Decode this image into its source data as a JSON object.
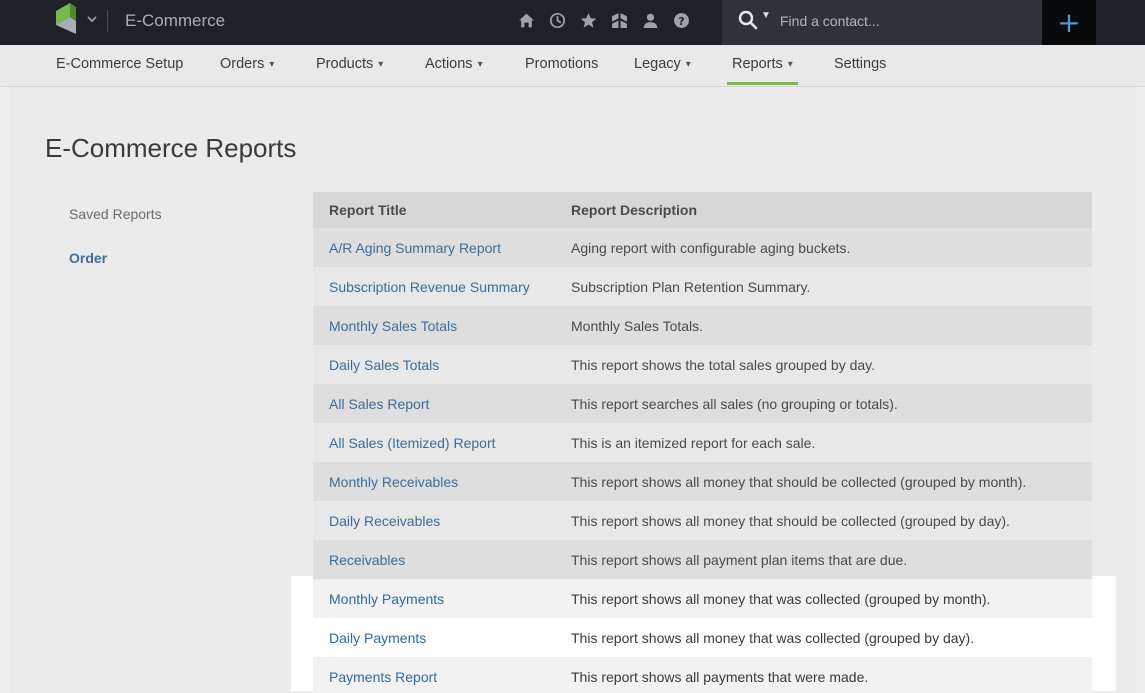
{
  "app": {
    "title": "E-Commerce"
  },
  "search": {
    "placeholder": "Find a contact..."
  },
  "add_label": "+",
  "nav": {
    "items": [
      {
        "label": "E-Commerce Setup"
      },
      {
        "label": "Orders"
      },
      {
        "label": "Products"
      },
      {
        "label": "Actions"
      },
      {
        "label": "Promotions"
      },
      {
        "label": "Legacy"
      },
      {
        "label": "Reports"
      },
      {
        "label": "Settings"
      }
    ]
  },
  "page": {
    "title": "E-Commerce Reports"
  },
  "sidebar": {
    "items": [
      {
        "label": "Saved Reports"
      },
      {
        "label": "Order"
      }
    ]
  },
  "table": {
    "headers": [
      "Report Title",
      "Report Description"
    ],
    "rows": [
      {
        "title": "A/R Aging Summary Report",
        "description": "Aging report with configurable aging buckets."
      },
      {
        "title": "Subscription Revenue Summary",
        "description": "Subscription Plan Retention Summary."
      },
      {
        "title": "Monthly Sales Totals",
        "description": "Monthly Sales Totals."
      },
      {
        "title": "Daily Sales Totals",
        "description": "This report shows the total sales grouped by day."
      },
      {
        "title": "All Sales Report",
        "description": "This report searches all sales (no grouping or totals)."
      },
      {
        "title": "All Sales (Itemized) Report",
        "description": "This is an itemized report for each sale."
      },
      {
        "title": "Monthly Receivables",
        "description": "This report shows all money that should be collected (grouped by month)."
      },
      {
        "title": "Daily Receivables",
        "description": "This report shows all money that should be collected (grouped by day)."
      },
      {
        "title": "Receivables",
        "description": "This report shows all payment plan items that are due."
      },
      {
        "title": "Monthly Payments",
        "description": "This report shows all money that was collected (grouped by month)."
      },
      {
        "title": "Daily Payments",
        "description": "This report shows all money that was collected (grouped by day)."
      },
      {
        "title": "Payments Report",
        "description": "This report shows all payments that were made."
      }
    ]
  },
  "colors": {
    "topbar": "#1f2128",
    "accent_green": "#77b94a",
    "link_blue": "#3a6d9c",
    "add_button_plus": "#4f9ad8"
  }
}
